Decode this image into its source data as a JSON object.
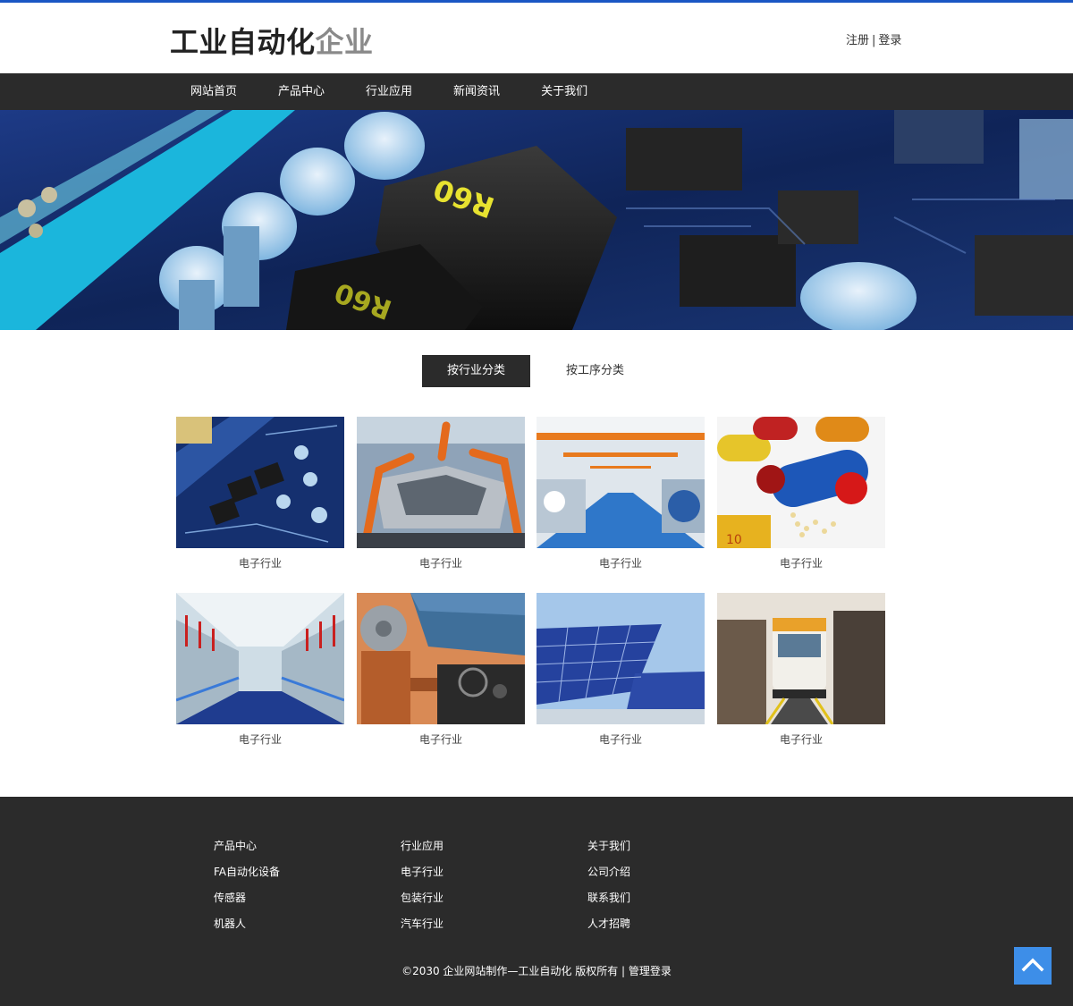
{
  "header": {
    "logo_dark": "工业自动化",
    "logo_gray": "企业",
    "register": "注册",
    "separator": "|",
    "login": "登录"
  },
  "nav": {
    "items": [
      {
        "label": "网站首页"
      },
      {
        "label": "产品中心"
      },
      {
        "label": "行业应用"
      },
      {
        "label": "新闻资讯"
      },
      {
        "label": "关于我们"
      }
    ]
  },
  "tabs": {
    "by_industry": "按行业分类",
    "by_process": "按工序分类"
  },
  "cards": [
    {
      "caption": "电子行业",
      "image": "circuit-board"
    },
    {
      "caption": "电子行业",
      "image": "robotic-car-assembly"
    },
    {
      "caption": "电子行业",
      "image": "factory-hall"
    },
    {
      "caption": "电子行业",
      "image": "pharmaceutical-capsules"
    },
    {
      "caption": "电子行业",
      "image": "textile-spinning"
    },
    {
      "caption": "电子行业",
      "image": "robot-driving"
    },
    {
      "caption": "电子行业",
      "image": "solar-panels"
    },
    {
      "caption": "电子行业",
      "image": "train"
    }
  ],
  "footer": {
    "col1": [
      "产品中心",
      "FA自动化设备",
      "传感器",
      "机器人"
    ],
    "col2": [
      "行业应用",
      "电子行业",
      "包装行业",
      "汽车行业"
    ],
    "col3": [
      "关于我们",
      "公司介绍",
      "联系我们",
      "人才招聘"
    ],
    "copyright": "©2030 企业网站制作—工业自动化 版权所有",
    "copyright_sep": " | ",
    "admin_login": "管理登录"
  },
  "banner": {
    "image": "circuit-board-closeup",
    "chip_label": "R60"
  },
  "colors": {
    "accent": "#1a56c4",
    "dark_bar": "#2b2b2b",
    "to_top": "#3d8ee8",
    "logo_gray": "#8a8a8a"
  },
  "icons": {
    "to_top": "chevron-up-icon"
  }
}
